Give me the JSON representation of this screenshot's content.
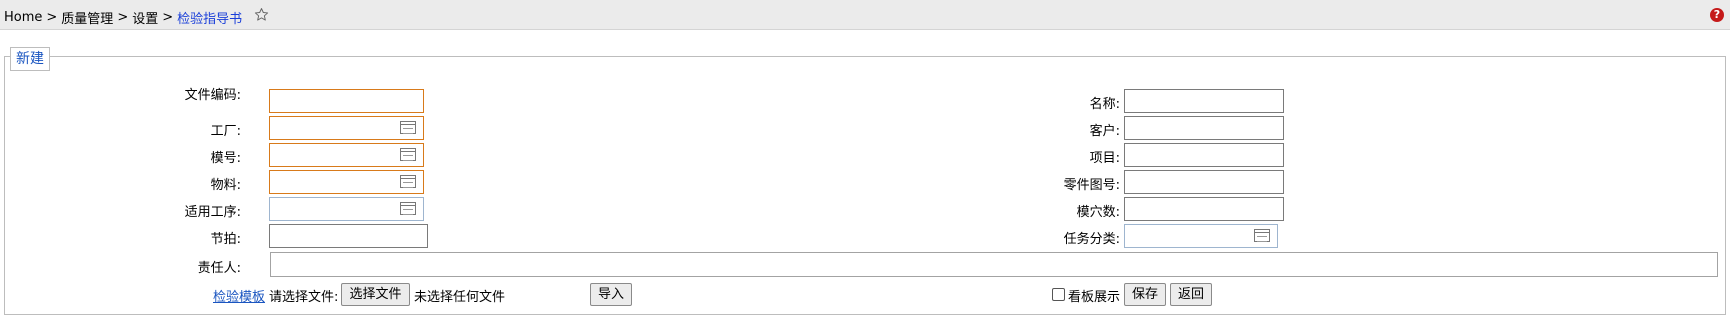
{
  "breadcrumb": {
    "items": [
      "Home",
      "质量管理",
      "设置"
    ],
    "separator": ">",
    "current": "检验指导书",
    "favorite_icon": "star-outline-icon",
    "help_icon": "help-icon",
    "help_label": "?"
  },
  "form": {
    "legend": "新建",
    "left_fields": {
      "file_code": {
        "label": "文件编码:",
        "value": ""
      },
      "factory": {
        "label": "工厂:",
        "value": ""
      },
      "mold_no": {
        "label": "模号:",
        "value": ""
      },
      "material": {
        "label": "物料:",
        "value": ""
      },
      "process": {
        "label": "适用工序:",
        "value": ""
      },
      "takt": {
        "label": "节拍:",
        "value": ""
      }
    },
    "right_fields": {
      "name": {
        "label": "名称:",
        "value": ""
      },
      "customer": {
        "label": "客户:",
        "value": ""
      },
      "project": {
        "label": "项目:",
        "value": ""
      },
      "part_drawing_no": {
        "label": "零件图号:",
        "value": ""
      },
      "cavity_count": {
        "label": "模穴数:",
        "value": ""
      },
      "task_category": {
        "label": "任务分类:",
        "value": ""
      }
    },
    "responsible": {
      "label": "责任人:",
      "value": ""
    },
    "template_link": "检验模板",
    "file_prompt": "请选择文件:",
    "choose_file_button": "选择文件",
    "no_file_text": "未选择任何文件",
    "import_button": "导入",
    "kanban_checkbox": {
      "label": "看板展示",
      "checked": false
    },
    "save_button": "保存",
    "back_button": "返回"
  },
  "colors": {
    "required_border": "#d87a1a",
    "link": "#1a55c0",
    "current_crumb": "#1a3fd9",
    "topbar_bg": "#ebebeb"
  }
}
